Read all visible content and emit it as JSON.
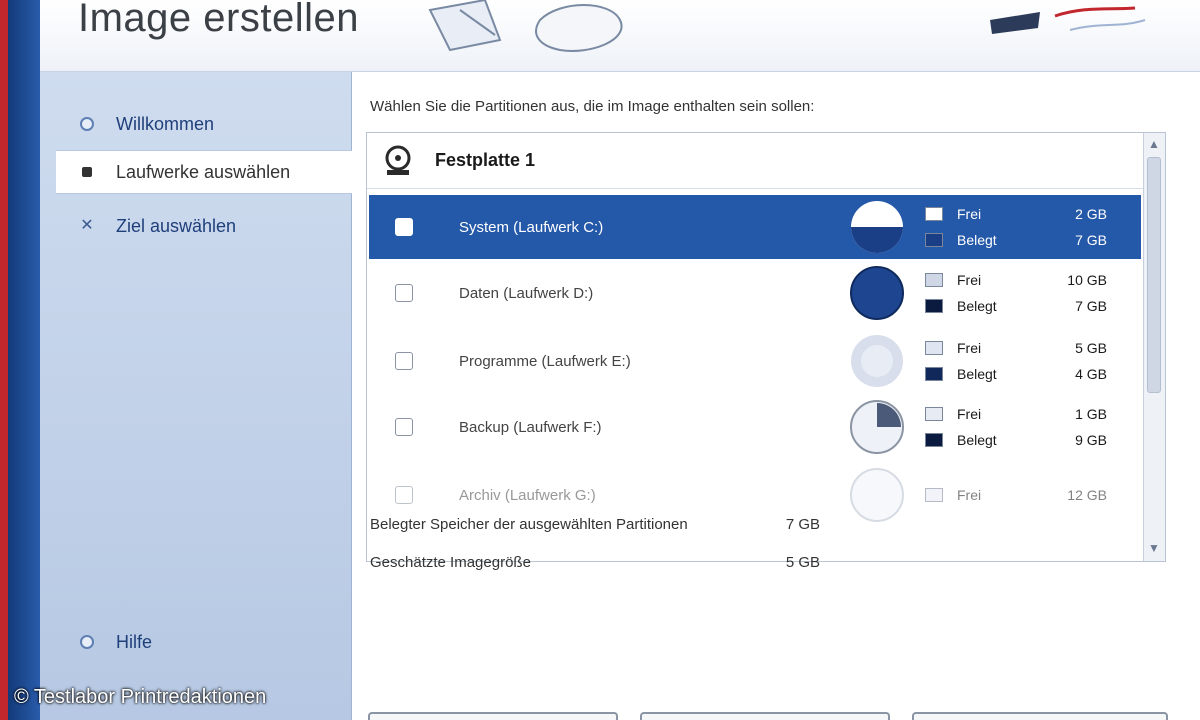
{
  "window": {
    "title": "Image erstellen"
  },
  "sidebar": {
    "items": [
      {
        "label": "Willkommen",
        "active": false
      },
      {
        "label": "Laufwerke auswählen",
        "active": true
      },
      {
        "label": "Ziel auswählen",
        "active": false
      }
    ],
    "bottom_items": [
      {
        "label": "Hilfe"
      }
    ]
  },
  "main": {
    "instruction": "Wählen Sie die Partitionen aus, die im Image enthalten sein sollen:",
    "group": {
      "label": "Festplatte 1"
    },
    "partitions": [
      {
        "name": "System (Laufwerk C:)",
        "selected": true,
        "usage": [
          {
            "label": "Frei",
            "value": "2 GB",
            "color": "#ffffff"
          },
          {
            "label": "Belegt",
            "value": "7 GB",
            "color": "#1a3f86"
          }
        ]
      },
      {
        "name": "Daten (Laufwerk D:)",
        "selected": false,
        "usage": [
          {
            "label": "Frei",
            "value": "10 GB",
            "color": "#cfd6e6"
          },
          {
            "label": "Belegt",
            "value": "7 GB",
            "color": "#0b1a3f"
          }
        ]
      },
      {
        "name": "Programme (Laufwerk E:)",
        "selected": false,
        "usage": [
          {
            "label": "Frei",
            "value": "5 GB",
            "color": "#dfe6f2"
          },
          {
            "label": "Belegt",
            "value": "4 GB",
            "color": "#10295a"
          }
        ]
      },
      {
        "name": "Backup (Laufwerk F:)",
        "selected": false,
        "usage": [
          {
            "label": "Frei",
            "value": "1 GB",
            "color": "#e6ebf4"
          },
          {
            "label": "Belegt",
            "value": "9 GB",
            "color": "#0b1a3f"
          }
        ]
      },
      {
        "name": "Archiv (Laufwerk G:)",
        "selected": false,
        "usage": [
          {
            "label": "Frei",
            "value": "12 GB",
            "color": "#e6ebf4"
          }
        ]
      }
    ],
    "summary": [
      {
        "label": "Belegter Speicher der ausgewählten Partitionen",
        "value": "7 GB"
      },
      {
        "label": "Geschätzte Imagegröße",
        "value": "5 GB"
      }
    ]
  },
  "copyright": "© Testlabor Printredaktionen",
  "colors": {
    "accent": "#2458a8",
    "sidebar": "#c4d4ea",
    "edge_red": "#c1272d",
    "edge_blue": "#1e4a92"
  }
}
